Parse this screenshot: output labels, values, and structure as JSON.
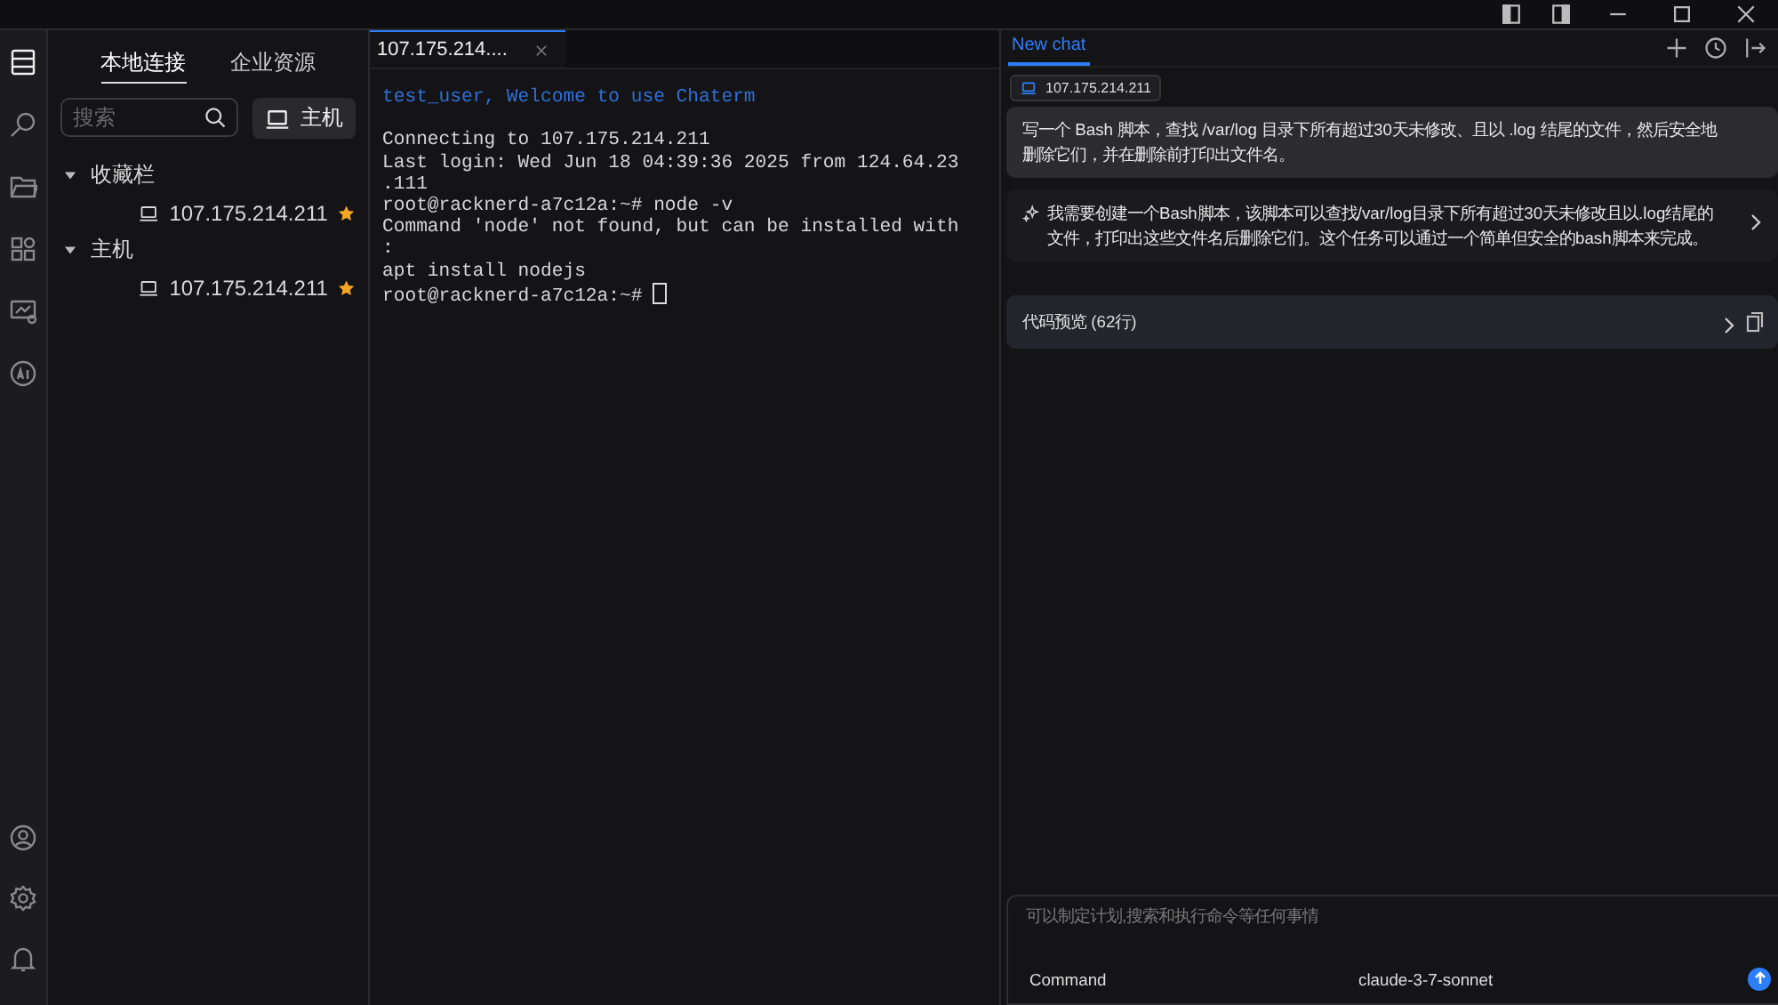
{
  "activity_bar": {
    "items": [
      {
        "selected": true
      },
      {
        "selected": false
      },
      {
        "selected": false
      },
      {
        "selected": false
      },
      {
        "selected": false
      },
      {
        "selected": false
      }
    ]
  },
  "sidebar": {
    "tabs": [
      {
        "label": "本地连接",
        "selected": true
      },
      {
        "label": "企业资源",
        "selected": false
      }
    ],
    "search": {
      "placeholder": "搜索"
    },
    "host_button": "主机",
    "tree": [
      {
        "label": "收藏栏",
        "expanded": true,
        "children": [
          {
            "label": "107.175.214.211",
            "favorite": true
          }
        ]
      },
      {
        "label": "主机",
        "expanded": true,
        "children": [
          {
            "label": "107.175.214.211",
            "favorite": true
          }
        ]
      }
    ]
  },
  "terminal": {
    "tabs": [
      {
        "label": "107.175.214....",
        "selected": true
      }
    ],
    "lines": [
      {
        "kind": "welcome",
        "text": "test_user, Welcome to use Chaterm"
      },
      {
        "kind": "blank"
      },
      {
        "kind": "output",
        "text": "Connecting to 107.175.214.211"
      },
      {
        "kind": "output",
        "text": "Last login: Wed Jun 18 04:39:36 2025 from 124.64.23"
      },
      {
        "kind": "output",
        "text": ".111"
      },
      {
        "kind": "output",
        "text": "root@racknerd-a7c12a:~# node -v"
      },
      {
        "kind": "output",
        "text": "Command 'node' not found, but can be installed with"
      },
      {
        "kind": "output",
        "text": ":"
      },
      {
        "kind": "output",
        "text": "apt install nodejs"
      },
      {
        "kind": "prompt",
        "text": "root@racknerd-a7c12a:~#"
      }
    ]
  },
  "chat": {
    "tabs": [
      {
        "label": "New chat",
        "selected": true
      }
    ],
    "host_tag": "107.175.214.211",
    "messages": [
      {
        "kind": "user",
        "text": "写一个 Bash 脚本，查找 /var/log 目录下所有超过30天未修改、且以 .log 结尾的文件，然后安全地删除它们，并在删除前打印出文件名。"
      },
      {
        "kind": "assistant",
        "text": "我需要创建一个Bash脚本，该脚本可以查找/var/log目录下所有超过30天未修改且以.log结尾的文件，打印出这些文件名后删除它们。这个任务可以通过一个简单但安全的bash脚本来完成。"
      }
    ],
    "code_preview": "代码预览 (62行)",
    "input": {
      "placeholder": "可以制定计划,搜索和执行命令等任何事情",
      "mode": "Command",
      "model": "claude-3-7-sonnet"
    }
  }
}
